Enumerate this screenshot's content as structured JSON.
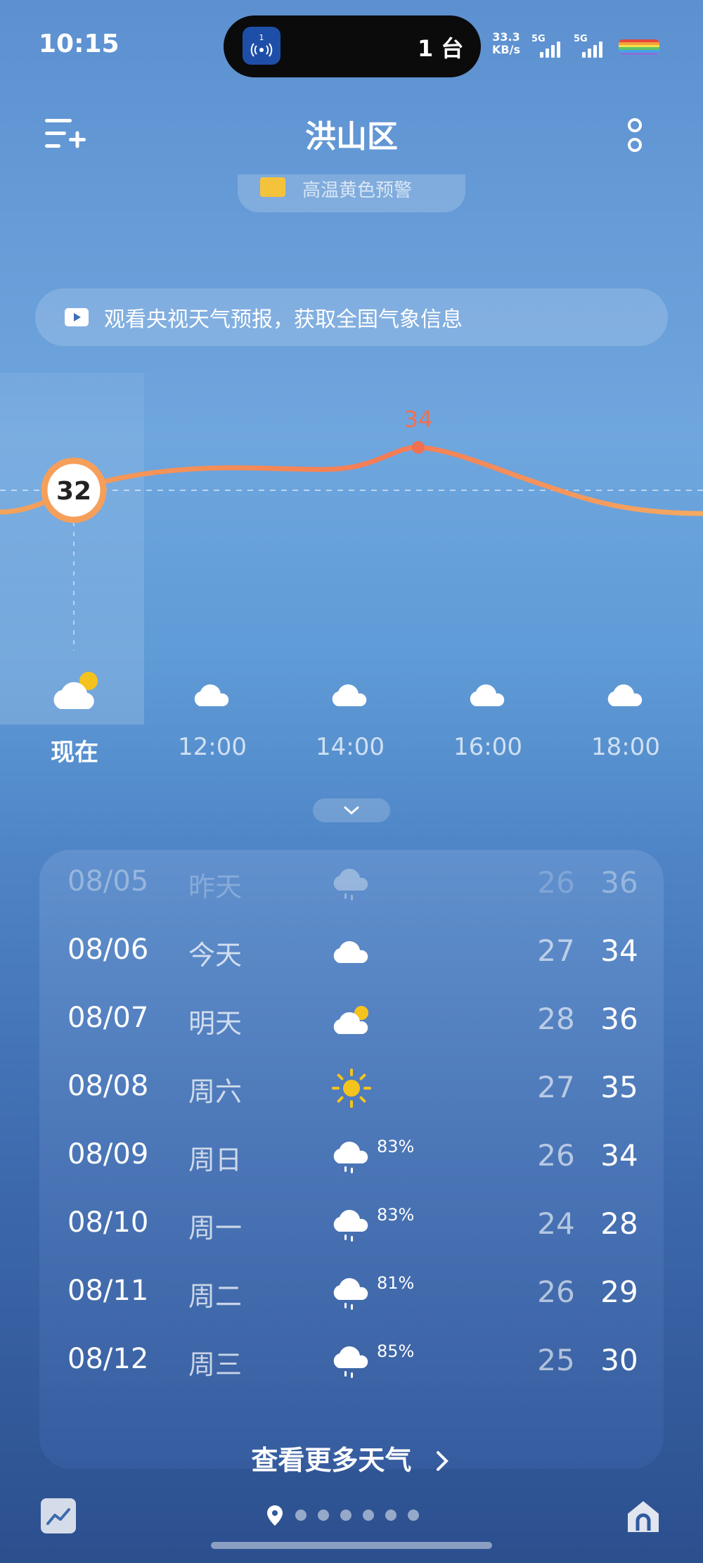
{
  "status_bar": {
    "time": "10:15",
    "island_badge": "1",
    "island_text": "1 台",
    "net_speed_value": "33.3",
    "net_speed_unit": "KB/s",
    "sim1_label": "5G",
    "sim2_label": "5G"
  },
  "header": {
    "city": "洪山区"
  },
  "alert": {
    "text": "高温黄色预警"
  },
  "banner": {
    "text": "观看央视天气预报，获取全国气象信息"
  },
  "hourly": {
    "current_temp": "32",
    "max_temp_label": "34",
    "items": [
      {
        "label": "现在",
        "icon": "partly-cloudy-icon"
      },
      {
        "label": "12:00",
        "icon": "cloud-icon"
      },
      {
        "label": "14:00",
        "icon": "cloud-icon"
      },
      {
        "label": "16:00",
        "icon": "cloud-icon"
      },
      {
        "label": "18:00",
        "icon": "cloud-icon"
      }
    ]
  },
  "daily": [
    {
      "date": "08/05",
      "day": "昨天",
      "icon": "rain-icon",
      "pct": "",
      "low": "26",
      "high": "36"
    },
    {
      "date": "08/06",
      "day": "今天",
      "icon": "cloud-icon",
      "pct": "",
      "low": "27",
      "high": "34"
    },
    {
      "date": "08/07",
      "day": "明天",
      "icon": "partly-cloudy-icon",
      "pct": "",
      "low": "28",
      "high": "36"
    },
    {
      "date": "08/08",
      "day": "周六",
      "icon": "sun-icon",
      "pct": "",
      "low": "27",
      "high": "35"
    },
    {
      "date": "08/09",
      "day": "周日",
      "icon": "rain-icon",
      "pct": "83%",
      "low": "26",
      "high": "34"
    },
    {
      "date": "08/10",
      "day": "周一",
      "icon": "rain-icon",
      "pct": "83%",
      "low": "24",
      "high": "28"
    },
    {
      "date": "08/11",
      "day": "周二",
      "icon": "rain-icon",
      "pct": "81%",
      "low": "26",
      "high": "29"
    },
    {
      "date": "08/12",
      "day": "周三",
      "icon": "rain-icon",
      "pct": "85%",
      "low": "25",
      "high": "30"
    }
  ],
  "more_link": "查看更多天气",
  "colors": {
    "temp_curve": "#f58a5a",
    "temp_peak": "#f07050",
    "sun": "#f5c31e"
  }
}
